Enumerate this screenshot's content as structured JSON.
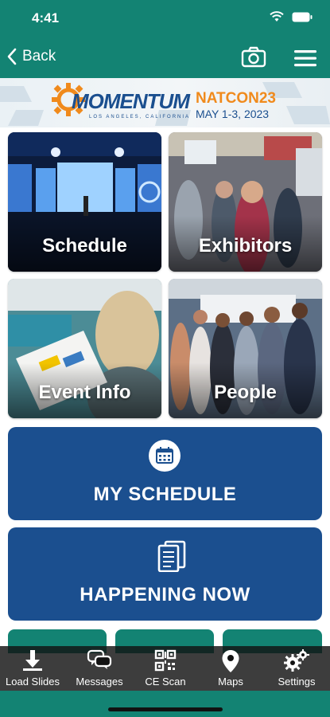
{
  "status": {
    "time": "4:41"
  },
  "nav": {
    "back_label": "Back"
  },
  "banner": {
    "logo_text": "MOMENTUM",
    "logo_sub": "LOS ANGELES, CALIFORNIA",
    "event": "NATCON23",
    "dates": "MAY 1-3, 2023"
  },
  "tiles": [
    {
      "label": "Schedule"
    },
    {
      "label": "Exhibitors"
    },
    {
      "label": "Event Info"
    },
    {
      "label": "People"
    }
  ],
  "buttons": {
    "my_schedule": "MY SCHEDULE",
    "happening_now": "HAPPENING NOW"
  },
  "tabbar": {
    "items": [
      {
        "label": "Load Slides",
        "icon": "download-icon"
      },
      {
        "label": "Messages",
        "icon": "chat-bubbles-icon"
      },
      {
        "label": "CE Scan",
        "icon": "qr-code-icon"
      },
      {
        "label": "Maps",
        "icon": "map-pin-icon"
      },
      {
        "label": "Settings",
        "icon": "gears-icon"
      }
    ]
  },
  "colors": {
    "teal": "#138373",
    "navy": "#1b4f8f",
    "orange": "#f08a1c"
  }
}
